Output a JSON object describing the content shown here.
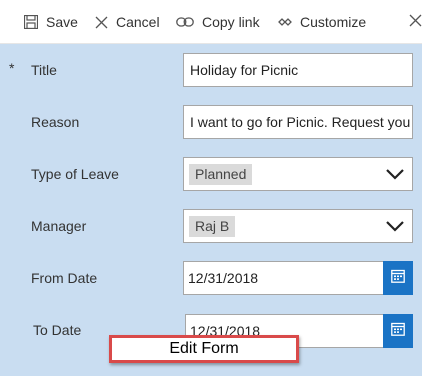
{
  "toolbar": {
    "save_label": "Save",
    "cancel_label": "Cancel",
    "copy_link_label": "Copy link",
    "customize_label": "Customize"
  },
  "form": {
    "title": {
      "required_marker": "*",
      "label": "Title",
      "value": "Holiday for Picnic"
    },
    "reason": {
      "label": "Reason",
      "value": "I want to go for Picnic. Request you"
    },
    "type_of_leave": {
      "label": "Type of Leave",
      "value": "Planned"
    },
    "manager": {
      "label": "Manager",
      "value": "Raj B"
    },
    "from_date": {
      "label": "From Date",
      "value": "12/31/2018"
    },
    "to_date": {
      "label": "To Date",
      "value": "12/31/2018"
    }
  },
  "annotation": {
    "label": "Edit Form"
  },
  "colors": {
    "form_background": "#c9ddf1",
    "calendar_button": "#1a73c5",
    "annotation_border": "#d94a4a"
  },
  "icons": [
    "save-icon",
    "cancel-icon",
    "link-icon",
    "customize-icon",
    "close-icon",
    "chevron-down-icon",
    "calendar-icon"
  ]
}
